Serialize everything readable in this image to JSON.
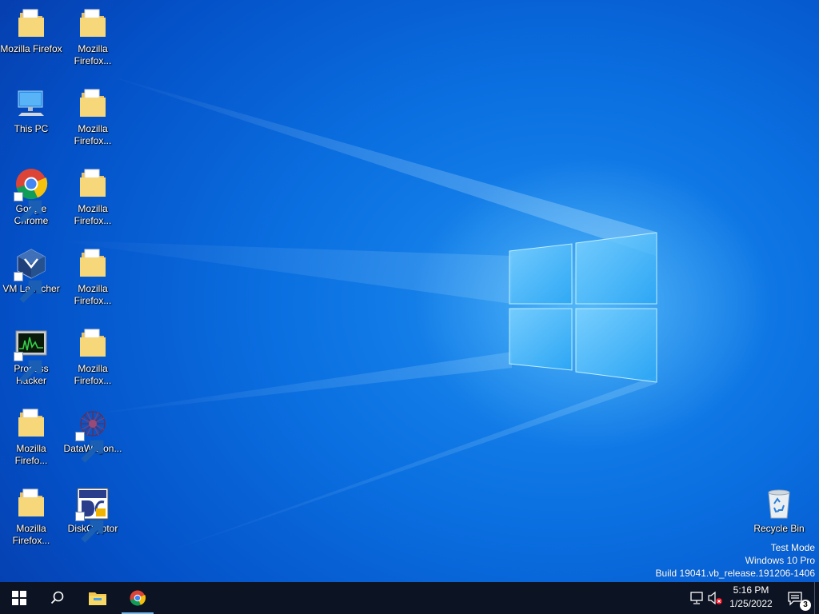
{
  "desktop_icons": [
    {
      "name": "folder-firefox-1",
      "label": "Mozilla Firefox",
      "kind": "folder"
    },
    {
      "name": "folder-firefox-2",
      "label": "Mozilla Firefox...",
      "kind": "folder"
    },
    {
      "name": "this-pc",
      "label": "This PC",
      "kind": "computer"
    },
    {
      "name": "folder-firefox-3",
      "label": "Mozilla Firefox...",
      "kind": "folder"
    },
    {
      "name": "google-chrome",
      "label": "Google Chrome",
      "kind": "chrome"
    },
    {
      "name": "folder-firefox-4",
      "label": "Mozilla Firefox...",
      "kind": "folder"
    },
    {
      "name": "vm-launcher",
      "label": "VM Launcher",
      "kind": "virtualbox"
    },
    {
      "name": "folder-firefox-5",
      "label": "Mozilla Firefox...",
      "kind": "folder"
    },
    {
      "name": "process-hacker",
      "label": "Process Hacker",
      "kind": "monitor"
    },
    {
      "name": "folder-firefox-6",
      "label": "Mozilla Firefox...",
      "kind": "folder"
    },
    {
      "name": "folder-firefox-7",
      "label": "Mozilla Firefo...",
      "kind": "folder"
    },
    {
      "name": "datawagon",
      "label": "DataWagon...",
      "kind": "datawagon"
    },
    {
      "name": "folder-firefox-8",
      "label": "Mozilla Firefox...",
      "kind": "folder"
    },
    {
      "name": "diskcryptor",
      "label": "DiskCryptor",
      "kind": "diskcryptor"
    },
    {
      "name": "recycle-bin",
      "label": "Recycle Bin",
      "kind": "recycle"
    }
  ],
  "watermark": {
    "line1": "Test Mode",
    "line2": "Windows 10 Pro",
    "line3": "Build 19041.vb_release.191206-1406"
  },
  "taskbar": {
    "start_icon": "windows-logo-icon",
    "search_icon": "search-icon",
    "explorer_icon": "file-explorer-icon",
    "chrome_icon": "chrome-icon",
    "network_icon": "network-icon",
    "volume_icon": "volume-muted-icon",
    "time": "5:16 PM",
    "date": "1/25/2022",
    "notifications_icon": "action-center-icon",
    "notifications_count": "3"
  },
  "colors": {
    "accent": "#0a6fe0",
    "taskbar": "#0c1322"
  }
}
